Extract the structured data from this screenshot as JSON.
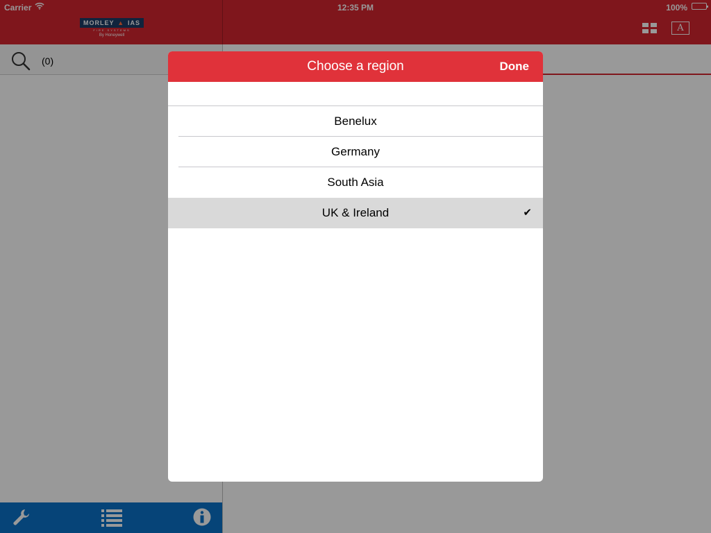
{
  "status_bar": {
    "carrier": "Carrier",
    "time": "12:35 PM",
    "battery_percent_label": "100%",
    "battery_level": 1.0,
    "wifi_icon": "wifi-icon"
  },
  "nav": {
    "logo": {
      "left_word": "MORLEY",
      "right_word": "IAS",
      "sub": "FIRE SYSTEMS",
      "by": "By Honeywell"
    },
    "grid_icon": "grid-icon",
    "font_button_label": "A"
  },
  "search": {
    "icon": "search-icon",
    "count": "(0)"
  },
  "tabbar": {
    "items": [
      {
        "icon": "wrench-icon"
      },
      {
        "icon": "list-icon"
      },
      {
        "icon": "info-icon"
      }
    ]
  },
  "modal": {
    "title": "Choose a region",
    "done_label": "Done",
    "regions": [
      {
        "label": "Benelux",
        "selected": false
      },
      {
        "label": "Germany",
        "selected": false
      },
      {
        "label": "South Asia",
        "selected": false
      },
      {
        "label": "UK & Ireland",
        "selected": true
      }
    ],
    "checkmark": "✔"
  },
  "colors": {
    "nav_red": "#d42630",
    "modal_header_red": "#e0323a",
    "tabbar_blue": "#0a72c8",
    "selected_row": "#d9d9d9"
  }
}
